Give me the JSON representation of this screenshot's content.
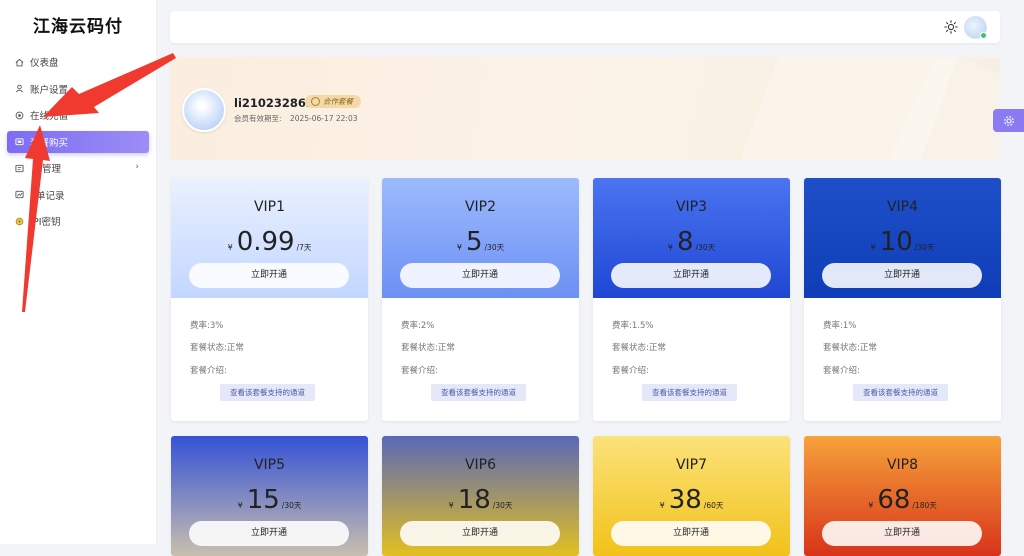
{
  "app": {
    "logo": "江海云码付"
  },
  "sidebar": {
    "items": [
      {
        "label": "仪表盘",
        "icon": "home-icon"
      },
      {
        "label": "账户设置",
        "icon": "user-icon"
      },
      {
        "label": "在线充值",
        "icon": "coin-icon"
      },
      {
        "label": "套餐购买",
        "icon": "package-icon",
        "active": true
      },
      {
        "label": "通道管理",
        "icon": "channel-icon",
        "has_children": true,
        "visible_label": "管理"
      },
      {
        "label": "订单记录",
        "icon": "order-icon",
        "visible_label": "单记录"
      },
      {
        "label": "API密钥",
        "icon": "key-icon",
        "visible_label": "PI密钥"
      }
    ]
  },
  "header": {
    "theme_icon": "sun-icon",
    "avatar_icon": "avatar-icon"
  },
  "profile": {
    "username": "li210232862",
    "badge": "合作套餐",
    "expire_label": "会员有效期至:",
    "expire_value": "2025-06-17 22:03"
  },
  "colors": {
    "accent": "#7c6cf2",
    "banner": "#fbeee0"
  },
  "plans": [
    {
      "name": "VIP1",
      "currency": "¥",
      "price": "0.99",
      "period": "/7天",
      "button": "立即开通",
      "rate": "费率:3%",
      "status": "套餐状态:正常",
      "intro": "套餐介绍:",
      "channel_btn": "查看该套餐支持的通道"
    },
    {
      "name": "VIP2",
      "currency": "¥",
      "price": "5",
      "period": "/30天",
      "button": "立即开通",
      "rate": "费率:2%",
      "status": "套餐状态:正常",
      "intro": "套餐介绍:",
      "channel_btn": "查看该套餐支持的通道"
    },
    {
      "name": "VIP3",
      "currency": "¥",
      "price": "8",
      "period": "/30天",
      "button": "立即开通",
      "rate": "费率:1.5%",
      "status": "套餐状态:正常",
      "intro": "套餐介绍:",
      "channel_btn": "查看该套餐支持的通道"
    },
    {
      "name": "VIP4",
      "currency": "¥",
      "price": "10",
      "period": "/30天",
      "button": "立即开通",
      "rate": "费率:1%",
      "status": "套餐状态:正常",
      "intro": "套餐介绍:",
      "channel_btn": "查看该套餐支持的通道"
    },
    {
      "name": "VIP5",
      "currency": "¥",
      "price": "15",
      "period": "/30天",
      "button": "立即开通"
    },
    {
      "name": "VIP6",
      "currency": "¥",
      "price": "18",
      "period": "/30天",
      "button": "立即开通"
    },
    {
      "name": "VIP7",
      "currency": "¥",
      "price": "38",
      "period": "/60天",
      "button": "立即开通"
    },
    {
      "name": "VIP8",
      "currency": "¥",
      "price": "68",
      "period": "/180天",
      "button": "立即开通"
    }
  ]
}
